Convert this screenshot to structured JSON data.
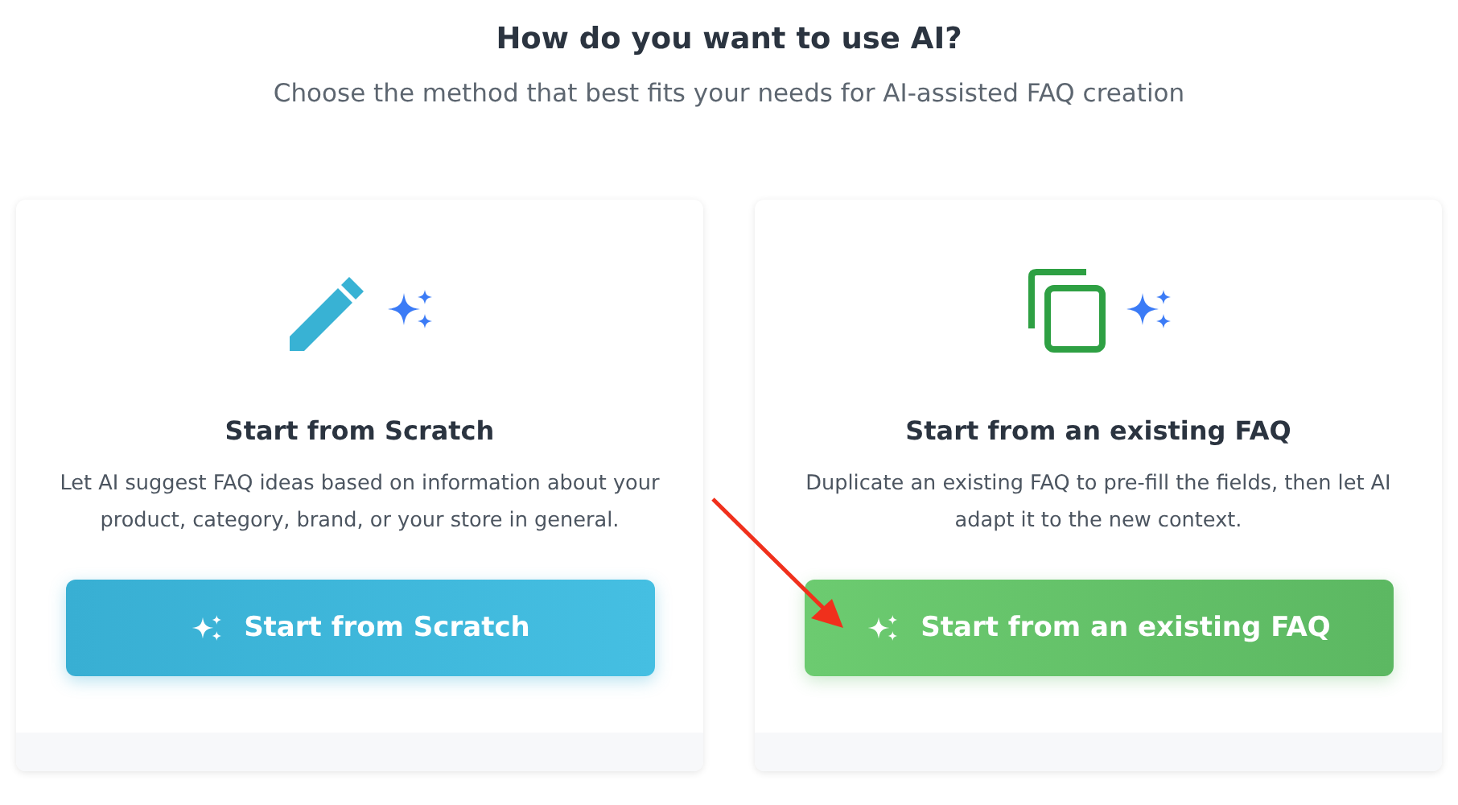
{
  "heading": "How do you want to use AI?",
  "subheading": "Choose the method that best fits your needs for AI-assisted FAQ creation",
  "cards": [
    {
      "kind": "scratch",
      "title": "Start from Scratch",
      "description": "Let AI suggest FAQ ideas based on information about your product, category, brand, or your store in general.",
      "button": "Start from Scratch"
    },
    {
      "kind": "duplicate",
      "title": "Start from an existing FAQ",
      "description": "Duplicate an existing FAQ to pre-fill the fields, then let AI adapt it to the new context.",
      "button": "Start from an existing FAQ"
    }
  ]
}
